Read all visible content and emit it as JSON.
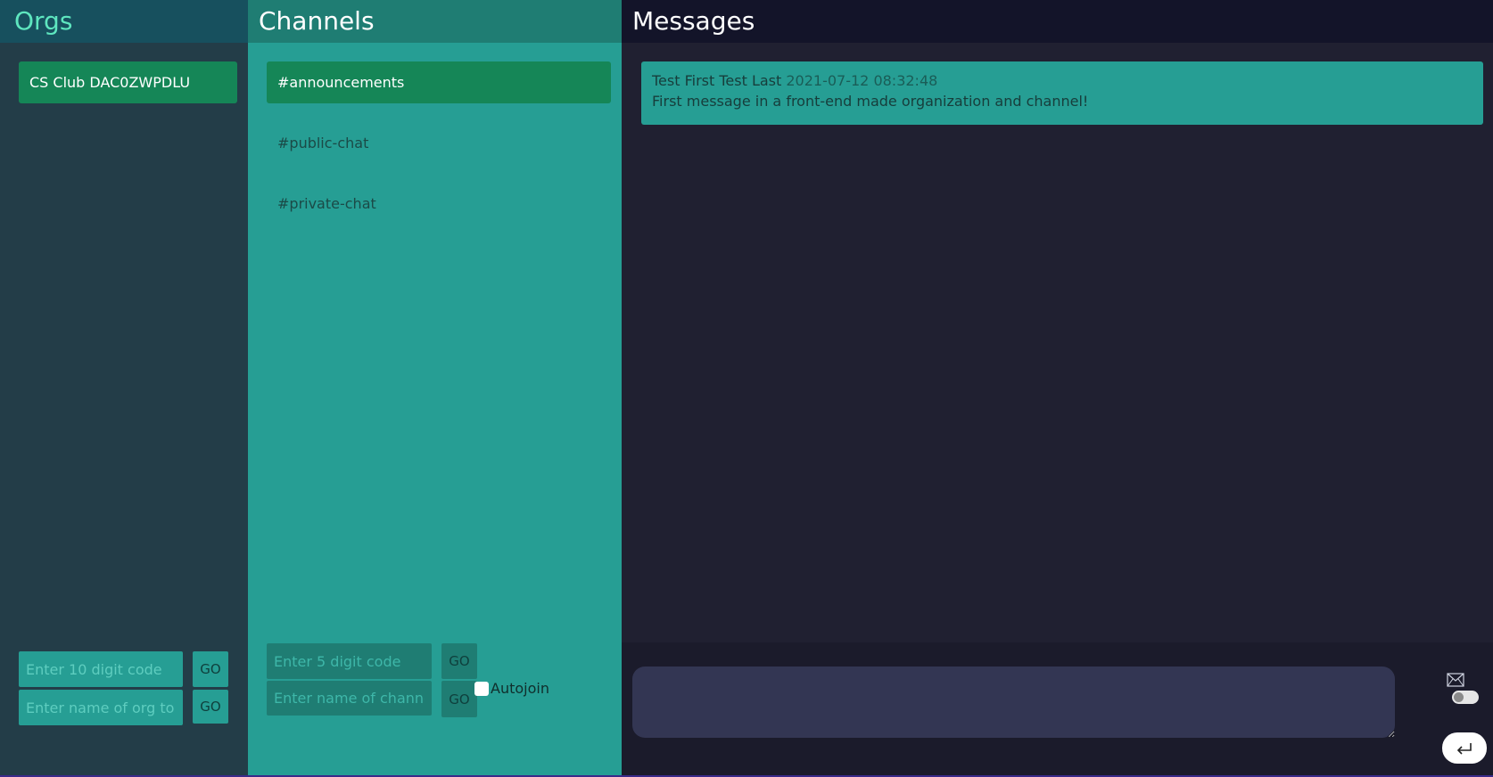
{
  "orgs": {
    "title": "Orgs",
    "items": [
      {
        "label": "CS Club DAC0ZWPDLU"
      }
    ],
    "code_input": {
      "placeholder": "Enter 10 digit code",
      "value": ""
    },
    "code_go": "GO",
    "name_input": {
      "placeholder": "Enter name of org to create",
      "value": ""
    },
    "name_go": "GO"
  },
  "channels": {
    "title": "Channels",
    "items": [
      {
        "label": "#announcements",
        "active": true
      },
      {
        "label": "#public-chat",
        "active": false
      },
      {
        "label": "#private-chat",
        "active": false
      }
    ],
    "code_input": {
      "placeholder": "Enter 5 digit code",
      "value": ""
    },
    "code_go": "GO",
    "name_input": {
      "placeholder": "Enter name of channel to create",
      "value": ""
    },
    "name_go": "GO",
    "autojoin_label": "Autojoin",
    "autojoin_checked": false
  },
  "messages": {
    "title": "Messages",
    "items": [
      {
        "author": "Test First Test Last",
        "timestamp": "2021-07-12 08:32:48",
        "body": "First message in a front-end made organization and channel!"
      }
    ],
    "composer": {
      "value": ""
    },
    "toggle_on": false,
    "icons": {
      "mail": "envelope-icon",
      "send": "enter-arrow-icon"
    }
  },
  "colors": {
    "org_selected": "#158657",
    "channel_panel": "#269e94",
    "messages_bg": "#202031"
  }
}
